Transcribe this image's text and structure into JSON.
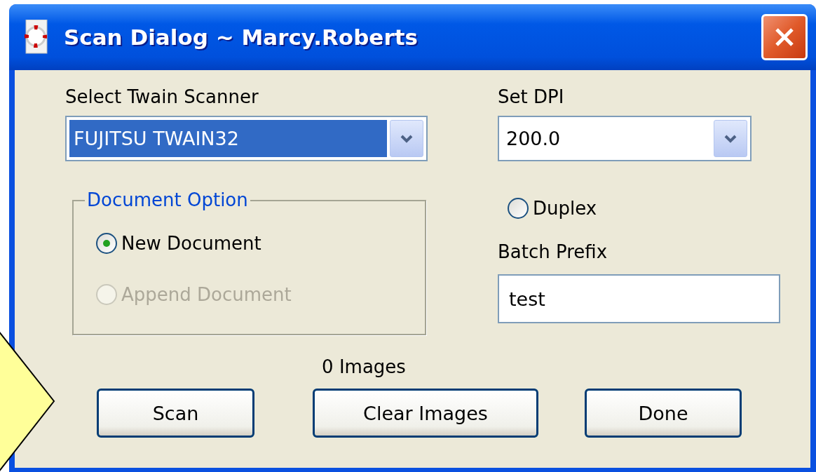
{
  "window": {
    "title": "Scan Dialog ~ Marcy.Roberts"
  },
  "scanner": {
    "label": "Select Twain Scanner",
    "value": "FUJITSU TWAIN32",
    "focused": true
  },
  "dpi": {
    "label": "Set DPI",
    "value": "200.0",
    "focused": false
  },
  "document_option": {
    "legend": "Document Option",
    "options": [
      {
        "label": "New Document",
        "selected": true,
        "disabled": false
      },
      {
        "label": "Append Document",
        "selected": false,
        "disabled": true
      }
    ]
  },
  "duplex": {
    "label": "Duplex",
    "checked": false
  },
  "batch_prefix": {
    "label": "Batch Prefix",
    "value": "test"
  },
  "image_count": "0 Images",
  "buttons": [
    {
      "label": "Scan"
    },
    {
      "label": "Clear Images"
    },
    {
      "label": "Done"
    }
  ]
}
